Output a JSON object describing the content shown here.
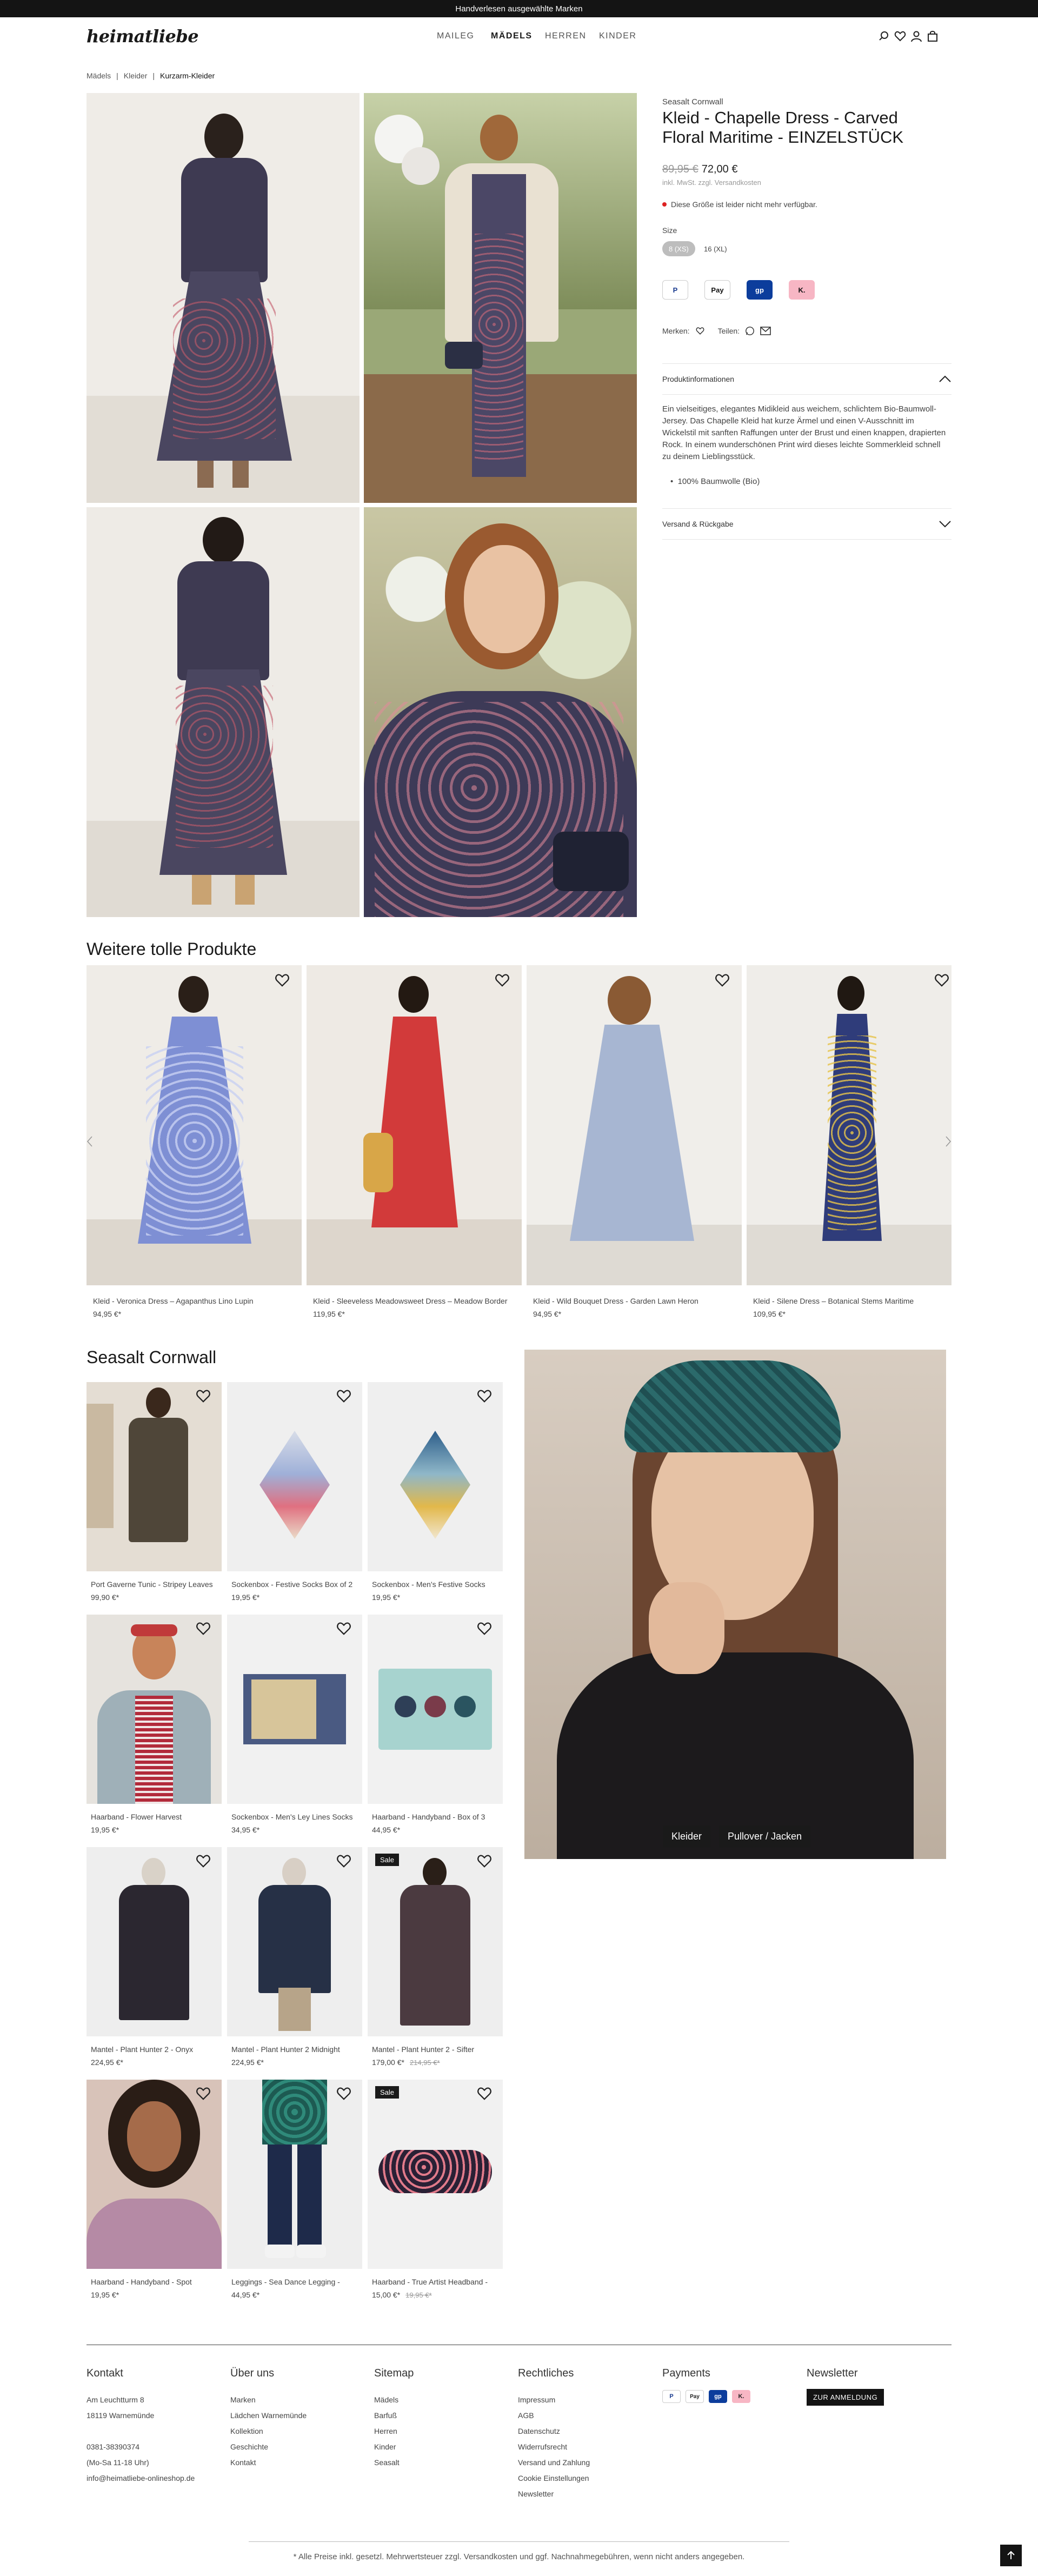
{
  "topbar": {
    "text": "Handverlesen ausgewählte Marken"
  },
  "header": {
    "logo": "heimatliebe",
    "nav": [
      "MAILEG",
      "MÄDELS",
      "HERREN",
      "KINDER"
    ],
    "icons": [
      "search-icon",
      "heart-icon",
      "user-icon",
      "bag-icon"
    ]
  },
  "breadcrumb": [
    "Mädels",
    "Kleider",
    "Kurzarm-Kleider"
  ],
  "product": {
    "brand": "Seasalt Cornwall",
    "title": "Kleid - Chapelle Dress - Carved Floral Maritime - EINZELSTÜCK",
    "old_price": "89,95 €",
    "price": "72,00 €",
    "tax_note": "inkl. MwSt. zzgl. Versandkosten",
    "availability": "Diese Größe ist leider nicht mehr verfügbar.",
    "size_label": "Size",
    "sizes": [
      "8 (XS)",
      "16 (XL)"
    ],
    "payments": [
      "PayPal",
      "Apple Pay",
      "giropay",
      "Klarna"
    ],
    "remember_label": "Merken:",
    "share_label": "Teilen:",
    "accordion_info": "Produktinformationen",
    "description": "Ein vielseitiges, elegantes Midikleid aus weichem, schlichtem Bio-Baumwoll-Jersey. Das Chapelle Kleid hat kurze Ärmel und einen V-Ausschnitt im Wickelstil mit sanften Raffungen unter der Brust und einen knappen, drapierten Rock. In einem wunderschönen Print wird dieses leichte Sommerkleid schnell zu deinem Lieblingsstück.",
    "bullet": "100% Baumwolle (Bio)",
    "accordion_shipping": "Versand & Rückgabe"
  },
  "recommendations": {
    "title": "Weitere tolle Produkte",
    "items": [
      {
        "name": "Kleid - Veronica Dress – Agapanthus Lino Lupin",
        "price": "94,95 €*"
      },
      {
        "name": "Kleid - Sleeveless Meadowsweet Dress – Meadow Border",
        "price": "119,95 €*"
      },
      {
        "name": "Kleid - Wild Bouquet Dress - Garden Lawn Heron",
        "price": "94,95 €*"
      },
      {
        "name": "Kleid - Silene Dress – Botanical Stems Maritime",
        "price": "109,95 €*"
      }
    ]
  },
  "brand_section": {
    "title": "Seasalt Cornwall",
    "items": [
      {
        "name": "Port Gaverne Tunic - Stripey Leaves",
        "price": "99,90 €*",
        "sale": "",
        "old": ""
      },
      {
        "name": "Sockenbox - Festive Socks Box of 2",
        "price": "19,95 €*",
        "sale": "",
        "old": ""
      },
      {
        "name": "Sockenbox - Men's Festive Socks",
        "price": "19,95 €*",
        "sale": "",
        "old": ""
      },
      {
        "name": "Haarband - Flower Harvest",
        "price": "19,95 €*",
        "sale": "",
        "old": ""
      },
      {
        "name": "Sockenbox - Men's Ley Lines Socks",
        "price": "34,95 €*",
        "sale": "",
        "old": ""
      },
      {
        "name": "Haarband - Handyband - Box of 3",
        "price": "44,95 €*",
        "sale": "",
        "old": ""
      },
      {
        "name": "Mantel - Plant Hunter 2 - Onyx",
        "price": "224,95 €*",
        "sale": "",
        "old": ""
      },
      {
        "name": "Mantel - Plant Hunter 2 Midnight",
        "price": "224,95 €*",
        "sale": "",
        "old": ""
      },
      {
        "name": "Mantel - Plant Hunter 2 - Sifter",
        "price": "179,00 €*",
        "sale": "Sale",
        "old": "214,95 €*"
      },
      {
        "name": "Haarband - Handyband - Spot",
        "price": "19,95 €*",
        "sale": "",
        "old": ""
      },
      {
        "name": "Leggings - Sea Dance Legging -",
        "price": "44,95 €*",
        "sale": "",
        "old": ""
      },
      {
        "name": "Haarband - True Artist Headband -",
        "price": "15,00 €*",
        "sale": "Sale",
        "old": "19,95 €*"
      }
    ],
    "feature_buttons": [
      "Kleider",
      "Pullover / Jacken"
    ]
  },
  "footer": {
    "contact": {
      "title": "Kontakt",
      "lines": [
        "Am Leuchtturm 8",
        "18119 Warnemünde",
        "",
        "0381-38390374",
        "(Mo-Sa 11-18 Uhr)",
        "info@heimatliebe-onlineshop.de"
      ]
    },
    "about": {
      "title": "Über uns",
      "links": [
        "Marken",
        "Lädchen Warnemünde",
        "Kollektion",
        "Geschichte",
        "Kontakt"
      ]
    },
    "sitemap": {
      "title": "Sitemap",
      "links": [
        "Mädels",
        "Barfuß",
        "Herren",
        "Kinder",
        "Seasalt"
      ]
    },
    "legal": {
      "title": "Rechtliches",
      "links": [
        "Impressum",
        "AGB",
        "Datenschutz",
        "Widerrufsrecht",
        "Versand und Zahlung",
        "Cookie Einstellungen",
        "Newsletter"
      ]
    },
    "payments": {
      "title": "Payments"
    },
    "newsletter": {
      "title": "Newsletter",
      "button": "ZUR ANMELDUNG"
    },
    "note": "* Alle Preise inkl. gesetzl. Mehrwertsteuer zzgl. Versandkosten und ggf. Nachnahmegebühren, wenn nicht anders angegeben."
  },
  "colors": {
    "topbar": "#141414",
    "accent_red": "#d22222",
    "text": "#222222",
    "divider": "#e4e4e4"
  }
}
